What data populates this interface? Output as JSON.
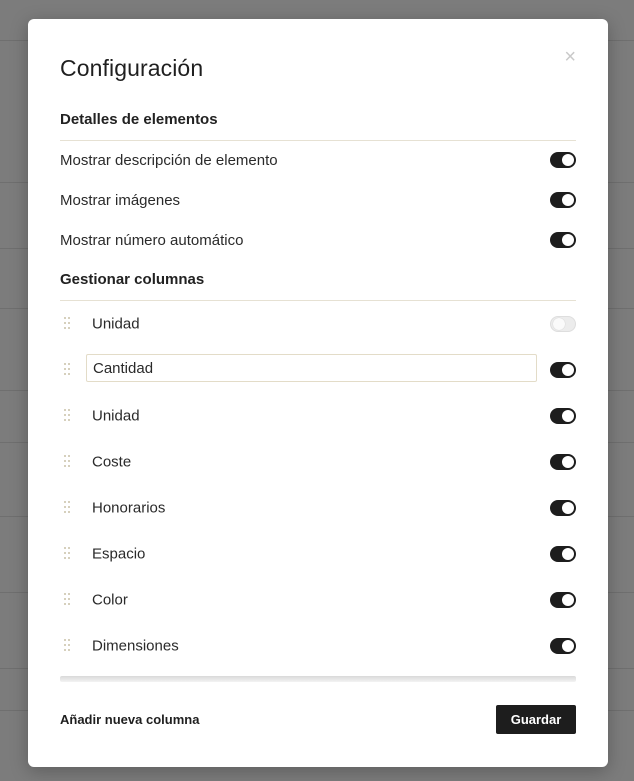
{
  "modal": {
    "title": "Configuración",
    "close_glyph": "×",
    "sections": {
      "item_details": {
        "title": "Detalles de elementos",
        "options": [
          {
            "label": "Mostrar descripción de elemento",
            "enabled": true
          },
          {
            "label": "Mostrar imágenes",
            "enabled": true
          },
          {
            "label": "Mostrar número automático",
            "enabled": true
          }
        ]
      },
      "manage_columns": {
        "title": "Gestionar columnas",
        "columns": [
          {
            "label": "Unidad",
            "enabled": false,
            "editing": false
          },
          {
            "label": "Cantidad",
            "enabled": true,
            "editing": true
          },
          {
            "label": "Unidad",
            "enabled": true,
            "editing": false
          },
          {
            "label": "Coste",
            "enabled": true,
            "editing": false
          },
          {
            "label": "Honorarios",
            "enabled": true,
            "editing": false
          },
          {
            "label": "Espacio",
            "enabled": true,
            "editing": false
          },
          {
            "label": "Color",
            "enabled": true,
            "editing": false
          },
          {
            "label": "Dimensiones",
            "enabled": true,
            "editing": false
          }
        ]
      }
    },
    "footer": {
      "add_column_label": "Añadir nueva columna",
      "save_label": "Guardar"
    }
  },
  "colors": {
    "toggle_on": "#1d1d1d",
    "toggle_off": "#ececec",
    "divider": "#e6e1d3",
    "overlay": "#7c7c7c"
  }
}
